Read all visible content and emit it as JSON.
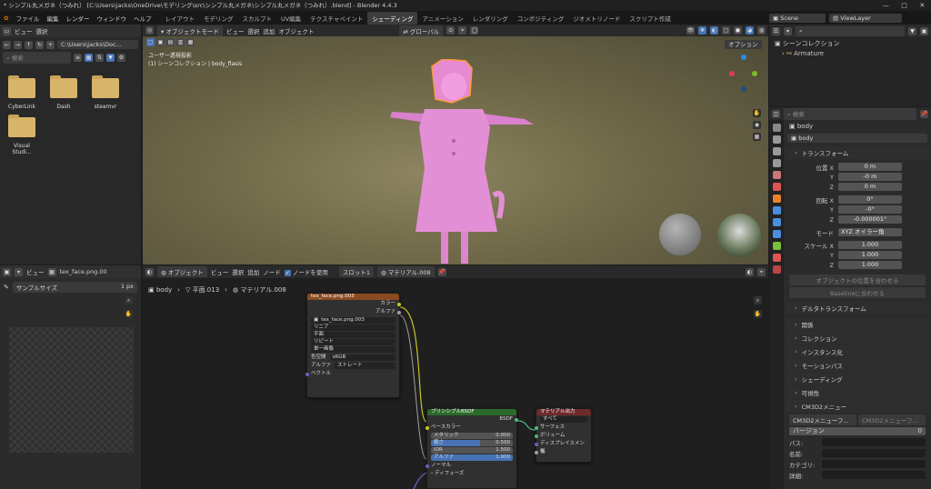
{
  "window": {
    "title": "* シンプル丸メガネ（つみれ） [C:\\Users\\jacks\\OneDrive\\モデリング\\src\\シンプル丸メガネ\\シンプル丸メガネ（つみれ）.blend] - Blender 4.4.3"
  },
  "menu": {
    "items": [
      "ファイル",
      "編集",
      "レンダー",
      "ウィンドウ",
      "ヘルプ"
    ]
  },
  "workspaces": [
    {
      "label": "レイアウト",
      "active": false
    },
    {
      "label": "モデリング",
      "active": false
    },
    {
      "label": "スカルプト",
      "active": false
    },
    {
      "label": "UV編集",
      "active": false
    },
    {
      "label": "テクスチャペイント",
      "active": false
    },
    {
      "label": "シェーディング",
      "active": true
    },
    {
      "label": "アニメーション",
      "active": false
    },
    {
      "label": "レンダリング",
      "active": false
    },
    {
      "label": "コンポジティング",
      "active": false
    },
    {
      "label": "ジオメトリノード",
      "active": false
    },
    {
      "label": "スクリプト作成",
      "active": false
    }
  ],
  "scene": {
    "name": "Scene",
    "view_layer": "ViewLayer"
  },
  "file_browser": {
    "menu": [
      "ビュー",
      "選択"
    ],
    "path": "C:\\Users\\jacks\\Doc...",
    "search_placeholder": "検索",
    "items": [
      "CyberLink",
      "Dash",
      "steamvr",
      "Visual Studi..."
    ]
  },
  "viewport": {
    "mode": "オブジェクトモード",
    "menu": [
      "ビュー",
      "選択",
      "追加",
      "オブジェクト"
    ],
    "transform": "グローバル",
    "options": "オプション",
    "info_line1": "ユーザー透視投影",
    "info_line2": "(1) シーンコレクション | body_flasis"
  },
  "outliner": {
    "root": "シーンコレクション",
    "armature": "Armature"
  },
  "image_editor": {
    "menu": "ビュー",
    "image": "tex_face.png.00",
    "sample_label": "サンプルサイズ",
    "sample_value": "1 px"
  },
  "node_editor": {
    "object_label": "オブジェクト",
    "menu": [
      "ビュー",
      "選択",
      "追加",
      "ノード"
    ],
    "use_nodes": "ノードを使用",
    "slot": "スロット1",
    "material": "マテリアル.008",
    "breadcrumb": [
      "body",
      "平面.013",
      "マテリアル.008"
    ]
  },
  "tex_node": {
    "title": "tex_face.png.003",
    "out_color": "カラー",
    "out_alpha": "アルファ",
    "image": "tex_face.png.003",
    "interpolation": "リニア",
    "projection": "平面",
    "extension": "リピート",
    "source": "単一画像",
    "colorspace_label": "色空間",
    "colorspace": "sRGB",
    "alpha_label": "アルファ",
    "alpha": "ストレート",
    "vector": "ベクトル"
  },
  "bsdf_node": {
    "title": "プリンシプルBSDF",
    "output": "BSDF",
    "base_color": "ベースカラー",
    "metallic_label": "メタリック",
    "metallic": "0.000",
    "roughness_label": "粗さ",
    "roughness": "0.500",
    "ior_label": "IOR",
    "ior": "1.500",
    "alpha_label": "アルファ",
    "alpha": "1.000",
    "normal": "ノーマル",
    "diffuse": "ディフューズ",
    "subsurface": "サブサーフェス"
  },
  "out_node": {
    "title": "マテリアル出力",
    "target": "すべて",
    "surface": "サーフェス",
    "volume": "ボリューム",
    "displacement": "ディスプレイスメント",
    "thickness": "幅"
  },
  "properties": {
    "search_placeholder": "検索",
    "object": "body",
    "object_field": "body",
    "transform_title": "トランスフォーム",
    "location_label": "位置 X",
    "loc_x": "0 m",
    "loc_y": "-0 m",
    "loc_z": "0 m",
    "rotation_label": "回転 X",
    "rot_x": "0°",
    "rot_y": "-0°",
    "rot_z": "-0.000001°",
    "mode_label": "モード",
    "mode": "XYZ オイラー角",
    "scale_label": "スケール X",
    "scale_x": "1.000",
    "scale_y": "1.000",
    "scale_z": "1.000",
    "y": "Y",
    "z": "Z",
    "btn_align": "オブジェクトの位置を合わせる",
    "btn_baseline": "Baselineに合わせる",
    "sections": [
      "デルタトランスフォーム",
      "関係",
      "コレクション",
      "インスタンス化",
      "モーションパス",
      "シェーディング",
      "可視性"
    ],
    "cm3d2": {
      "title": "CM3D2メニュー",
      "btn1": "CM3D2メニューフ...",
      "btn2": "CM3D2メニューフ...",
      "version_label": "バージョン",
      "version": "0",
      "path": "パス:",
      "name": "名前:",
      "category": "カテゴリ:",
      "detail": "詳細:"
    }
  }
}
